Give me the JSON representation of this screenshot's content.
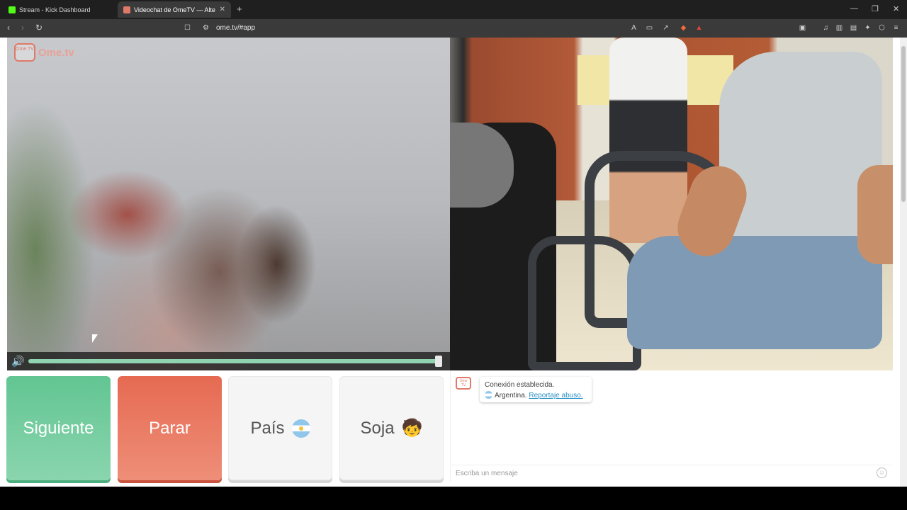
{
  "browser": {
    "tabs": [
      {
        "title": "Stream - Kick Dashboard",
        "favicon_color": "#53fc18"
      },
      {
        "title": "Videochat de OmeTV — Alte",
        "favicon_color": "#e07a68"
      }
    ],
    "url": "ome.tv/#app"
  },
  "site": {
    "logo_badge": "Ome TV",
    "logo_text": "Ome.tv"
  },
  "controls": {
    "next_label": "Siguiente",
    "stop_label": "Parar",
    "country_label": "País",
    "gender_label": "Soja",
    "gender_emoji": "🧒",
    "volume_level": 1.0
  },
  "chat": {
    "messages": [
      {
        "line1": "Conexión establecida.",
        "country": "Argentina.",
        "report_link": "Reportaje abuso."
      }
    ],
    "input_placeholder": "Escriba un mensaje"
  },
  "colors": {
    "next": "#62c592",
    "stop": "#e66a52",
    "brand": "#e07a68"
  }
}
